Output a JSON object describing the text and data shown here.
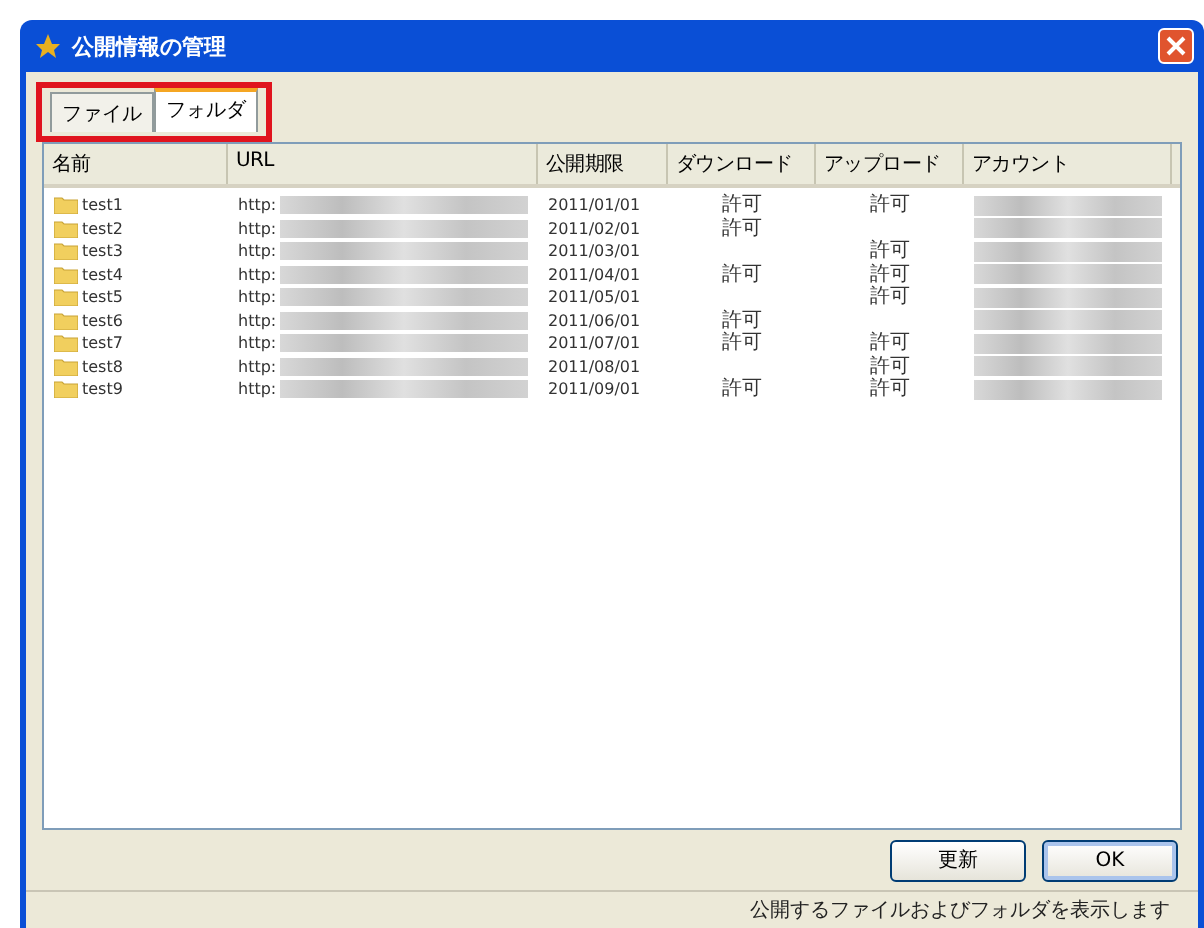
{
  "window": {
    "title": "公開情報の管理"
  },
  "tabs": [
    {
      "label": "ファイル",
      "selected": false
    },
    {
      "label": "フォルダ",
      "selected": true
    }
  ],
  "tabs_highlighted": true,
  "table": {
    "columns": [
      "名前",
      "URL",
      "公開期限",
      "ダウンロード",
      "アップロード",
      "アカウント"
    ],
    "rows": [
      {
        "name": "test1",
        "url": "http:",
        "expires": "2011/01/01",
        "download": "許可",
        "upload": "許可"
      },
      {
        "name": "test2",
        "url": "http:",
        "expires": "2011/02/01",
        "download": "許可"
      },
      {
        "name": "test3",
        "url": "http:",
        "expires": "2011/03/01",
        "upload": "許可"
      },
      {
        "name": "test4",
        "url": "http:",
        "expires": "2011/04/01",
        "download": "許可",
        "upload": "許可"
      },
      {
        "name": "test5",
        "url": "http:",
        "expires": "2011/05/01",
        "upload": "許可"
      },
      {
        "name": "test6",
        "url": "http:",
        "expires": "2011/06/01",
        "download": "許可"
      },
      {
        "name": "test7",
        "url": "http:",
        "expires": "2011/07/01",
        "download": "許可",
        "upload": "許可"
      },
      {
        "name": "test8",
        "url": "http:",
        "expires": "2011/08/01",
        "upload": "許可"
      },
      {
        "name": "test9",
        "url": "http:",
        "expires": "2011/09/01",
        "download": "許可",
        "upload": "許可"
      }
    ]
  },
  "buttons": [
    "更新",
    "OK"
  ],
  "status_bar": "公開するファイルおよびフォルダを表示します"
}
